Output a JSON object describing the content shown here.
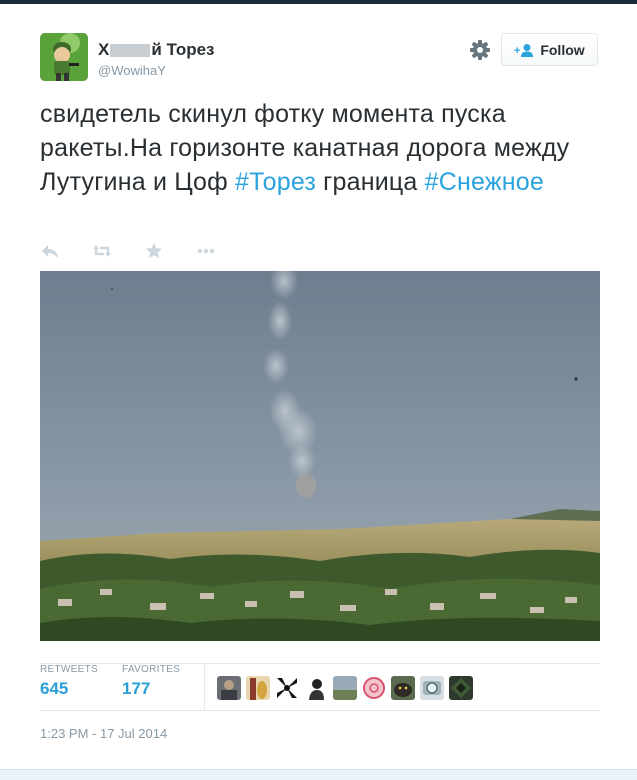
{
  "tweet": {
    "user": {
      "name_prefix": "Х",
      "name_suffix": "й Торез",
      "handle": "@WowihaY"
    },
    "follow_label": "Follow",
    "text": {
      "plain_1": "свидетель скинул фотку момента пуска ракеты.На горизонте канатная дорога между Лутугина и Цоф ",
      "hashtag_1": "#Торез",
      "plain_2": " граница ",
      "hashtag_2": "#Снежное"
    },
    "actions": [
      "reply-icon",
      "retweet-icon",
      "favorite-icon",
      "more-icon"
    ],
    "stats": {
      "retweets_label": "RETWEETS",
      "retweets_value": "645",
      "favorites_label": "FAVORITES",
      "favorites_value": "177"
    },
    "timestamp": "1:23 PM - 17 Jul 2014"
  },
  "colors": {
    "link": "#2aa3de",
    "muted": "#8899a6",
    "text": "#292f33",
    "border": "#e1e8ed"
  }
}
